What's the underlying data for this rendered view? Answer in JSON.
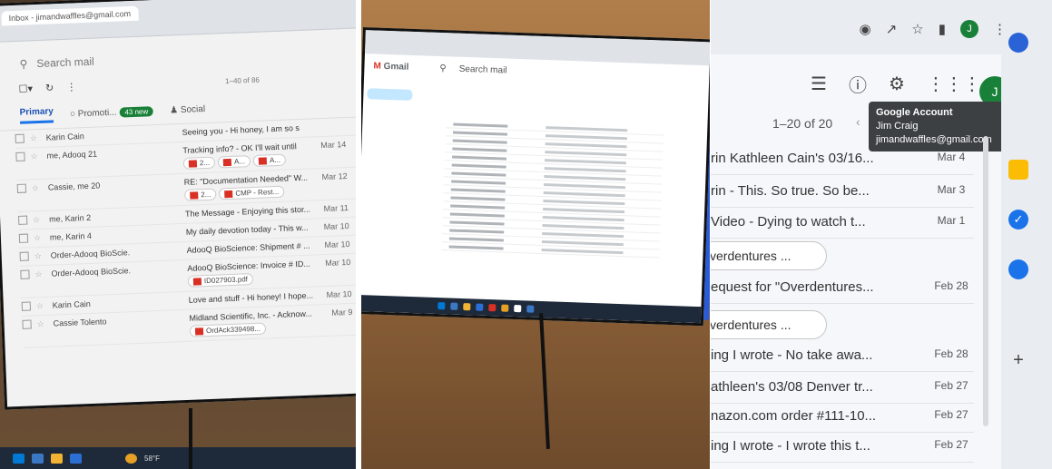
{
  "panel1": {
    "tab_title": "Inbox - jimandwaffles@gmail.com",
    "search_placeholder": "Search mail",
    "page_range": "1–40 of 86",
    "tabs": {
      "primary": "Primary",
      "promotions": "Promoti...",
      "promotions_badge": "43 new",
      "social": "Social"
    },
    "emails": [
      {
        "sender": "Karin Cain",
        "subject": "Seeing you - Hi honey, I am so s",
        "date": ""
      },
      {
        "sender": "me, Adooq 21",
        "subject": "Tracking info? - OK I'll wait until",
        "date": "Mar 14",
        "attachments": [
          "2...",
          "A...",
          "A..."
        ]
      },
      {
        "sender": "Cassie, me 20",
        "subject": "RE: \"Documentation Needed\" W...",
        "date": "Mar 12",
        "attachments": [
          "2...",
          "CMP - Rest..."
        ]
      },
      {
        "sender": "me, Karin 2",
        "subject": "The Message - Enjoying this stor...",
        "date": "Mar 11"
      },
      {
        "sender": "me, Karin 4",
        "subject": "My daily devotion today - This w...",
        "date": "Mar 10"
      },
      {
        "sender": "Order-Adooq BioScie.",
        "subject": "AdooQ BioScience: Shipment # ...",
        "date": "Mar 10"
      },
      {
        "sender": "Order-Adooq BioScie.",
        "subject": "AdooQ BioScience: Invoice # ID...",
        "date": "Mar 10",
        "attachments": [
          "ID027903.pdf"
        ]
      },
      {
        "sender": "Karin Cain",
        "subject": "Love and stuff - Hi honey! I hope...",
        "date": "Mar 10"
      },
      {
        "sender": "Cassie Tolento",
        "subject": "Midland Scientific, Inc. - Acknow...",
        "date": "Mar 9",
        "attachments": [
          "OrdAck339498..."
        ]
      }
    ],
    "taskbar_temp": "58°F"
  },
  "panel2": {
    "app_name": "Gmail",
    "search_placeholder": "Search mail"
  },
  "panel3": {
    "counter": "1–20 of 20",
    "avatar_initial": "J",
    "tooltip": {
      "title": "Google Account",
      "name": "Jim Craig",
      "email": "jimandwaffles@gmail.com"
    },
    "rows": [
      {
        "text": "rin Kathleen Cain's 03/16...",
        "date": "Mar 4"
      },
      {
        "text": "rin - This. So true. So be...",
        "date": "Mar 3"
      },
      {
        "text": "Video - Dying to watch t...",
        "date": "Mar 1"
      },
      {
        "text": "verdentures ...",
        "date": "",
        "chip": true
      },
      {
        "text": "equest for \"Overdentures...",
        "date": "Feb 28"
      },
      {
        "text": "verdentures ...",
        "date": "",
        "chip": true
      },
      {
        "text": "ing I wrote - No take awa...",
        "date": "Feb 28"
      },
      {
        "text": "athleen's 03/08 Denver tr...",
        "date": "Feb 27"
      },
      {
        "text": "nazon.com order #111-10...",
        "date": "Feb 27"
      },
      {
        "text": "ing I wrote - I wrote this t...",
        "date": "Feb 27"
      }
    ]
  },
  "colors": {
    "gmail_green": "#188038",
    "tooltip_bg": "#3c4043",
    "gmail_blue": "#1a73e8"
  }
}
